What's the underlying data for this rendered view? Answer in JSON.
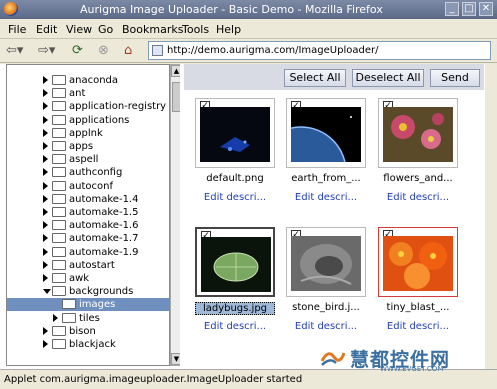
{
  "window": {
    "title": "Aurigma Image Uploader - Basic Demo - Mozilla Firefox",
    "min": "_",
    "max": "□",
    "close": "✕"
  },
  "menu": [
    "File",
    "Edit",
    "View",
    "Go",
    "Bookmarks",
    "Tools",
    "Help"
  ],
  "toolbar": {
    "url": "http://demo.aurigma.com/ImageUploader/"
  },
  "tree": {
    "items": [
      {
        "label": "anaconda",
        "expanded": false
      },
      {
        "label": "ant",
        "expanded": false
      },
      {
        "label": "application-registry",
        "expanded": false
      },
      {
        "label": "applications",
        "expanded": false
      },
      {
        "label": "applnk",
        "expanded": false
      },
      {
        "label": "apps",
        "expanded": false
      },
      {
        "label": "aspell",
        "expanded": false
      },
      {
        "label": "authconfig",
        "expanded": false
      },
      {
        "label": "autoconf",
        "expanded": false
      },
      {
        "label": "automake-1.4",
        "expanded": false
      },
      {
        "label": "automake-1.5",
        "expanded": false
      },
      {
        "label": "automake-1.6",
        "expanded": false
      },
      {
        "label": "automake-1.7",
        "expanded": false
      },
      {
        "label": "automake-1.9",
        "expanded": false
      },
      {
        "label": "autostart",
        "expanded": false
      },
      {
        "label": "awk",
        "expanded": false
      },
      {
        "label": "backgrounds",
        "expanded": true
      },
      {
        "label": "images",
        "expanded": false,
        "selected": true,
        "child": true
      },
      {
        "label": "tiles",
        "expanded": false,
        "child": true
      },
      {
        "label": "bison",
        "expanded": false
      },
      {
        "label": "blackjack",
        "expanded": false
      }
    ]
  },
  "uploader": {
    "select_all": "Select All",
    "deselect_all": "Deselect All",
    "send": "Send",
    "edit_label": "Edit descri...",
    "thumbnails": [
      {
        "name": "default.png",
        "checked": true
      },
      {
        "name": "earth_from_...",
        "checked": true
      },
      {
        "name": "flowers_and...",
        "checked": true
      },
      {
        "name": "ladybugs.jpg",
        "checked": true
      },
      {
        "name": "stone_bird.j...",
        "checked": true
      },
      {
        "name": "tiny_blast_...",
        "checked": true
      }
    ]
  },
  "status": {
    "text": "Applet com.aurigma.imageuploader.ImageUploader started"
  },
  "watermark": {
    "text": "慧都控件网",
    "sub": "WWW.EVGET.COM"
  }
}
